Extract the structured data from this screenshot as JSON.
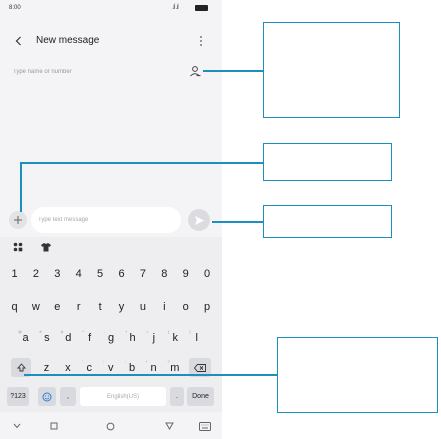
{
  "status_bar": {
    "time": "8:00",
    "signal": ".ıl .ıl"
  },
  "header": {
    "title": "New message"
  },
  "recipient": {
    "placeholder": "Type name or number"
  },
  "composer": {
    "placeholder": "Type text message"
  },
  "keyboard": {
    "row_numbers": [
      "1",
      "2",
      "3",
      "4",
      "5",
      "6",
      "7",
      "8",
      "9",
      "0"
    ],
    "row_top": [
      {
        "k": "q",
        "h": ""
      },
      {
        "k": "w",
        "h": ""
      },
      {
        "k": "e",
        "h": ""
      },
      {
        "k": "r",
        "h": ""
      },
      {
        "k": "t",
        "h": ""
      },
      {
        "k": "y",
        "h": ""
      },
      {
        "k": "u",
        "h": ""
      },
      {
        "k": "i",
        "h": ""
      },
      {
        "k": "o",
        "h": ""
      },
      {
        "k": "p",
        "h": ""
      }
    ],
    "row_home": [
      {
        "k": "a",
        "h": "@"
      },
      {
        "k": "s",
        "h": "#"
      },
      {
        "k": "d",
        "h": "&"
      },
      {
        "k": "f",
        "h": "*"
      },
      {
        "k": "g",
        "h": "-"
      },
      {
        "k": "h",
        "h": "+"
      },
      {
        "k": "j",
        "h": "="
      },
      {
        "k": "k",
        "h": "("
      },
      {
        "k": "l",
        "h": ")"
      }
    ],
    "row_bottom": [
      {
        "k": "z",
        "h": ""
      },
      {
        "k": "x",
        "h": ""
      },
      {
        "k": "c",
        "h": "'"
      },
      {
        "k": "v",
        "h": ":"
      },
      {
        "k": "b",
        "h": ";"
      },
      {
        "k": "n",
        "h": "!"
      },
      {
        "k": "m",
        "h": "?"
      }
    ],
    "symbols_label": "?123",
    "comma_label": ",",
    "space_label": "English(US)",
    "period_label": ".",
    "done_label": "Done"
  },
  "colors": {
    "callout": "#1a8fc0",
    "background": "#f4f4f6",
    "keyboard": "#eeeef0"
  },
  "icons": [
    "back-arrow-icon",
    "more-icon",
    "contact-icon",
    "plus-icon",
    "send-icon",
    "apps-icon",
    "shirt-icon",
    "shift-icon",
    "backspace-icon",
    "emoji-icon",
    "nav-back-icon",
    "nav-home-icon",
    "nav-recents-icon",
    "keyboard-icon"
  ]
}
